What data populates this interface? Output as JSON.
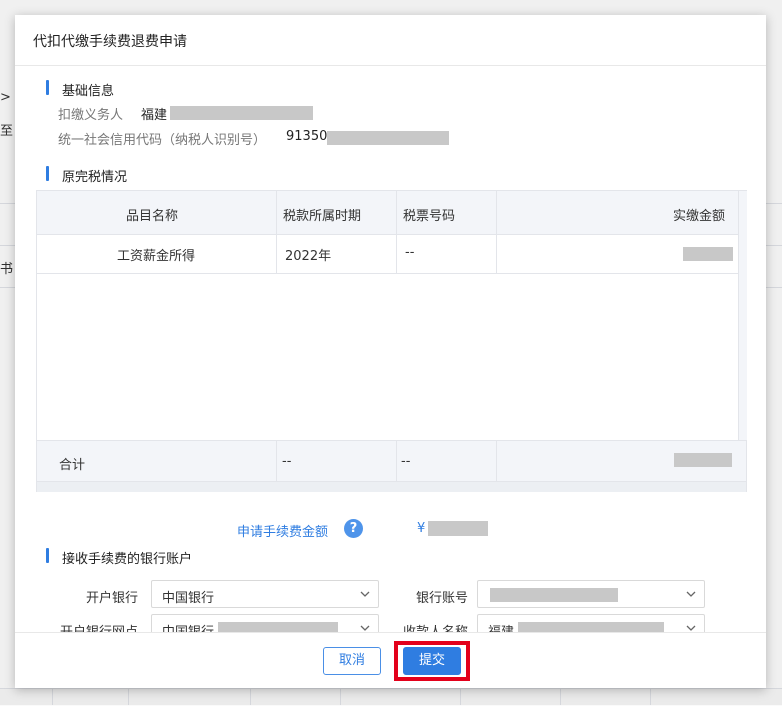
{
  "background": {
    "fragments": [
      ">",
      "至",
      "书"
    ]
  },
  "modal": {
    "title": "代扣代缴手续费退费申请",
    "basic_info": {
      "section_title": "基础信息",
      "withholder_label": "扣缴义务人",
      "withholder_value": "福建",
      "credit_code_label": "统一社会信用代码（纳税人识别号）",
      "credit_code_value": "91350"
    },
    "tax_section": {
      "section_title": "原完税情况",
      "columns": [
        "品目名称",
        "税款所属时期",
        "税票号码",
        "实缴金额"
      ],
      "rows": [
        {
          "item": "工资薪金所得",
          "period": "2022年",
          "ticket": "--",
          "amount": ""
        }
      ],
      "total": {
        "label": "合计",
        "period": "--",
        "ticket": "--",
        "amount": ""
      }
    },
    "fee": {
      "label": "申请手续费金额",
      "help_icon": "?",
      "value": "¥"
    },
    "bank_section": {
      "section_title": "接收手续费的银行账户",
      "bank_label": "开户银行",
      "bank_value": "中国银行",
      "account_label": "银行账号",
      "account_value": "",
      "branch_label": "开户银行网点",
      "branch_value": "中国银行",
      "payee_label": "收款人名称",
      "payee_value": "福建"
    },
    "footer": {
      "cancel_label": "取消",
      "submit_label": "提交"
    }
  },
  "colors": {
    "accent": "#2f7de1",
    "highlight": "#e3001b"
  }
}
